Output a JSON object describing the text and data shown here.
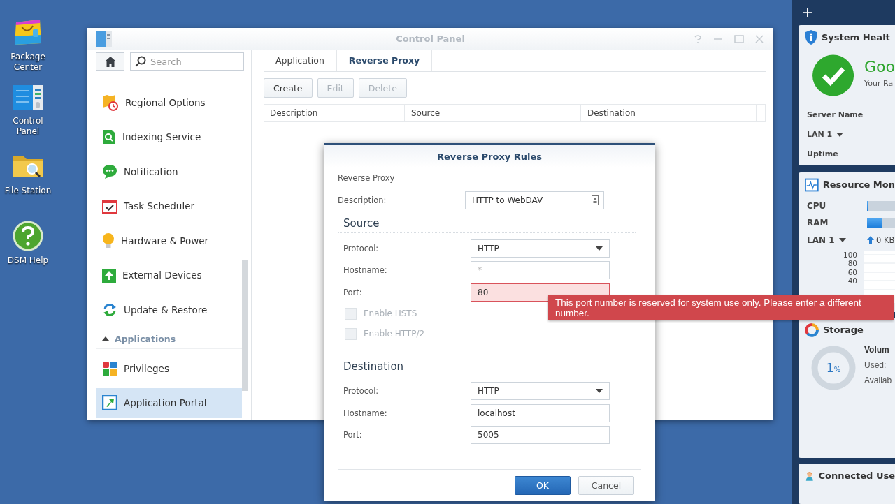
{
  "desktop_icons": [
    {
      "label": "Package Center",
      "kind": "package"
    },
    {
      "label": "Control Panel",
      "kind": "panel"
    },
    {
      "label": "File Station",
      "kind": "folder"
    },
    {
      "label": "DSM Help",
      "kind": "help"
    }
  ],
  "control_panel": {
    "title": "Control Panel",
    "search": {
      "placeholder": "Search"
    },
    "sidebar": [
      {
        "kind": "item",
        "label": "Regional Options",
        "selected": false
      },
      {
        "kind": "item",
        "label": "Indexing Service",
        "selected": false
      },
      {
        "kind": "item",
        "label": "Notification",
        "selected": false
      },
      {
        "kind": "item",
        "label": "Task Scheduler",
        "selected": false
      },
      {
        "kind": "item",
        "label": "Hardware & Power",
        "selected": false
      },
      {
        "kind": "item",
        "label": "External Devices",
        "selected": false
      },
      {
        "kind": "item",
        "label": "Update & Restore",
        "selected": false
      },
      {
        "kind": "header",
        "label": "Applications",
        "expanded": true
      },
      {
        "kind": "item",
        "label": "Privileges",
        "selected": false
      },
      {
        "kind": "item",
        "label": "Application Portal",
        "selected": true
      }
    ],
    "tabs": [
      {
        "label": "Application",
        "selected": false
      },
      {
        "label": "Reverse Proxy",
        "selected": true
      }
    ],
    "toolbar": [
      {
        "label": "Create",
        "disabled": false
      },
      {
        "label": "Edit",
        "disabled": true
      },
      {
        "label": "Delete",
        "disabled": true
      }
    ],
    "table": {
      "columns": [
        "Description",
        "Source",
        "Destination"
      ]
    }
  },
  "dialog": {
    "title": "Reverse Proxy Rules",
    "subtitle": "Reverse Proxy",
    "description": {
      "label": "Description:",
      "value": "HTTP to WebDAV"
    },
    "sections": [
      {
        "title": "Source",
        "fields": [
          {
            "label": "Protocol:",
            "kind": "select",
            "value": "HTTP"
          },
          {
            "label": "Hostname:",
            "kind": "text",
            "placeholder": "*",
            "invalid": false
          },
          {
            "label": "Port:",
            "kind": "text",
            "value": "80",
            "invalid": true
          }
        ],
        "checkboxes": [
          {
            "label": "Enable HSTS",
            "checked": false,
            "disabled": true
          },
          {
            "label": "Enable HTTP/2",
            "checked": false,
            "disabled": true
          }
        ]
      },
      {
        "title": "Destination",
        "fields": [
          {
            "label": "Protocol:",
            "kind": "select",
            "value": "HTTP"
          },
          {
            "label": "Hostname:",
            "kind": "text",
            "value": "localhost",
            "invalid": false
          },
          {
            "label": "Port:",
            "kind": "text",
            "value": "5005",
            "invalid": false
          }
        ]
      }
    ],
    "buttons": [
      {
        "label": "OK",
        "primary": true
      },
      {
        "label": "Cancel",
        "primary": false
      }
    ]
  },
  "error_tooltip": {
    "text": "This port number is reserved for system use only. Please enter a different number."
  },
  "widgets_panel": {
    "add": "+",
    "widgets": [
      {
        "kind": "health",
        "title": "System Healt",
        "status": "Goo",
        "note": "Your Ra",
        "rows": [
          {
            "label": "Server Name",
            "dropdown": false
          },
          {
            "label": "LAN 1",
            "dropdown": true
          },
          {
            "label": "Uptime",
            "dropdown": false
          }
        ]
      },
      {
        "kind": "resource",
        "title": "Resource Mon",
        "meters": [
          {
            "label": "CPU",
            "level": 0.01
          },
          {
            "label": "RAM",
            "level": 0.11
          }
        ],
        "network": {
          "label": "LAN 1",
          "reading": "0 KB"
        },
        "axis_labels": [
          "100",
          "80",
          "60",
          "40"
        ]
      },
      {
        "kind": "storage",
        "title": "Storage",
        "percent": "1",
        "unit": "%",
        "lines": [
          "Volum",
          "Used:",
          "Availab"
        ]
      },
      {
        "kind": "users",
        "title": "Connected Use"
      }
    ]
  }
}
